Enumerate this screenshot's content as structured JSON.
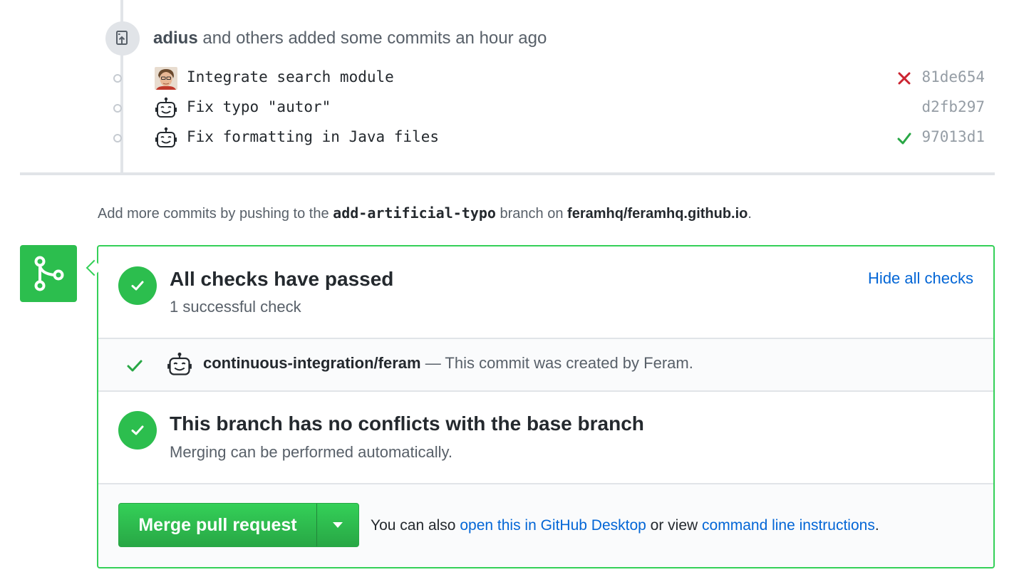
{
  "push_event": {
    "author": "adius",
    "text": "and others added some commits an hour ago"
  },
  "commits": [
    {
      "message": "Integrate search module",
      "sha": "81de654",
      "status": "failure",
      "avatar": "user-photo"
    },
    {
      "message": "Fix typo \"autor\"",
      "sha": "d2fb297",
      "status": "none",
      "avatar": "robot"
    },
    {
      "message": "Fix formatting in Java files",
      "sha": "97013d1",
      "status": "success",
      "avatar": "robot"
    }
  ],
  "hint": {
    "prefix": "Add more commits by pushing to the",
    "branch": "add-artificial-typo",
    "middle": "branch on",
    "repo": "feramhq/feramhq.github.io",
    "suffix": "."
  },
  "checks": {
    "title": "All checks have passed",
    "subtitle": "1 successful check",
    "hide_link": "Hide all checks",
    "items": [
      {
        "context": "continuous-integration/feram",
        "description": "— This commit was created by Feram."
      }
    ]
  },
  "conflicts": {
    "title": "This branch has no conflicts with the base branch",
    "subtitle": "Merging can be performed automatically."
  },
  "merge": {
    "button_label": "Merge pull request",
    "help_prefix": "You can also",
    "desktop_link": "open this in GitHub Desktop",
    "help_middle": "or view",
    "cli_link": "command line instructions",
    "help_suffix": "."
  },
  "colors": {
    "success": "#2cbe4e",
    "failure": "#cb2431",
    "link": "#0366d6",
    "border_success": "#34d058"
  }
}
